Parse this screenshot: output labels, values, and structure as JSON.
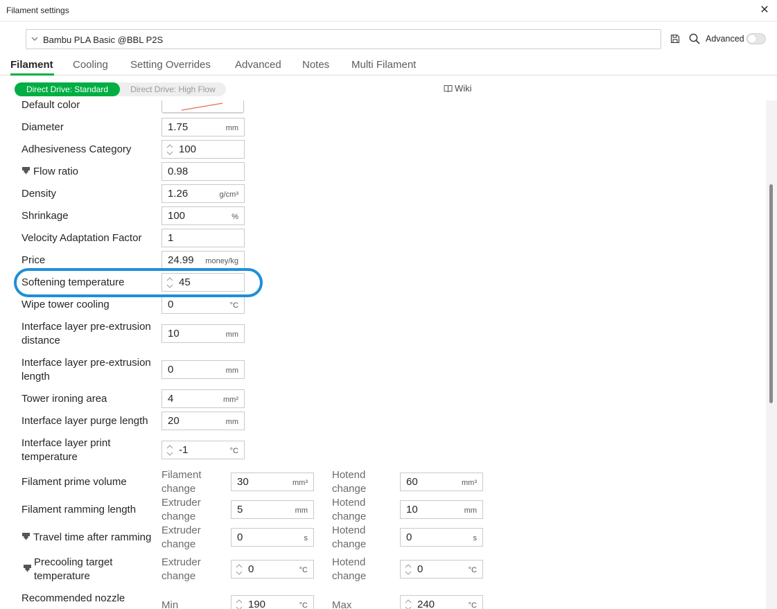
{
  "window": {
    "title": "Filament settings",
    "close_glyph": "✕"
  },
  "header": {
    "preset": "Bambu PLA Basic @BBL P2S",
    "advanced_label": "Advanced",
    "advanced_enabled": false
  },
  "tabs": [
    "Filament",
    "Cooling",
    "Setting Overrides",
    "Advanced",
    "Notes",
    "Multi Filament"
  ],
  "active_tab": "Filament",
  "variants": {
    "standard": "Direct Drive: Standard",
    "high_flow": "Direct Drive: High Flow"
  },
  "wiki_label": "Wiki",
  "accent_color": "#00ae42",
  "highlight_color": "#1e8fd8",
  "default_color_swatch": "#e86a52",
  "settings": {
    "default_color": {
      "label": "Default color"
    },
    "diameter": {
      "label": "Diameter",
      "value": "1.75",
      "unit": "mm"
    },
    "adhesiveness": {
      "label": "Adhesiveness Category",
      "value": "100"
    },
    "flow_ratio": {
      "label": "Flow ratio",
      "value": "0.98"
    },
    "density": {
      "label": "Density",
      "value": "1.26",
      "unit": "g/cm³"
    },
    "shrinkage": {
      "label": "Shrinkage",
      "value": "100",
      "unit": "%"
    },
    "velocity": {
      "label": "Velocity Adaptation Factor",
      "value": "1"
    },
    "price": {
      "label": "Price",
      "value": "24.99",
      "unit": "money/kg"
    },
    "softening": {
      "label": "Softening temperature",
      "value": "45"
    },
    "wipe_tower": {
      "label": "Wipe tower cooling",
      "value": "0",
      "unit": "°C"
    },
    "pre_extrusion_distance": {
      "label_line1": "Interface layer pre-extrusion",
      "label_line2": "distance",
      "value": "10",
      "unit": "mm"
    },
    "pre_extrusion_length": {
      "label_line1": "Interface layer pre-extrusion",
      "label_line2": "length",
      "value": "0",
      "unit": "mm"
    },
    "tower_ironing": {
      "label": "Tower ironing area",
      "value": "4",
      "unit": "mm²"
    },
    "purge_length": {
      "label": "Interface layer purge length",
      "value": "20",
      "unit": "mm"
    },
    "print_temp": {
      "label_line1": "Interface layer print",
      "label_line2": "temperature",
      "value": "-1",
      "unit": "°C"
    },
    "prime_volume": {
      "label": "Filament prime volume",
      "sub1_line1": "Filament",
      "sub1_line2": "change",
      "value1": "30",
      "unit1": "mm³",
      "sub2_line1": "Hotend",
      "sub2_line2": "change",
      "value2": "60",
      "unit2": "mm³"
    },
    "ramming_length": {
      "label": "Filament ramming length",
      "sub1_line1": "Extruder",
      "sub1_line2": "change",
      "value1": "5",
      "unit1": "mm",
      "sub2_line1": "Hotend",
      "sub2_line2": "change",
      "value2": "10",
      "unit2": "mm"
    },
    "travel_time": {
      "label": "Travel time after ramming",
      "sub1_line1": "Extruder",
      "sub1_line2": "change",
      "value1": "0",
      "unit1": "s",
      "sub2_line1": "Hotend",
      "sub2_line2": "change",
      "value2": "0",
      "unit2": "s"
    },
    "precooling": {
      "label_line1": "Precooling target",
      "label_line2": "temperature",
      "sub1_line1": "Extruder",
      "sub1_line2": "change",
      "value1": "0",
      "unit1": "°C",
      "sub2_line1": "Hotend",
      "sub2_line2": "change",
      "value2": "0",
      "unit2": "°C"
    },
    "nozzle_temp": {
      "label": "Recommended nozzle",
      "sub1": "Min",
      "value1": "190",
      "unit1": "°C",
      "sub2": "Max",
      "value2": "240",
      "unit2": "°C"
    }
  }
}
